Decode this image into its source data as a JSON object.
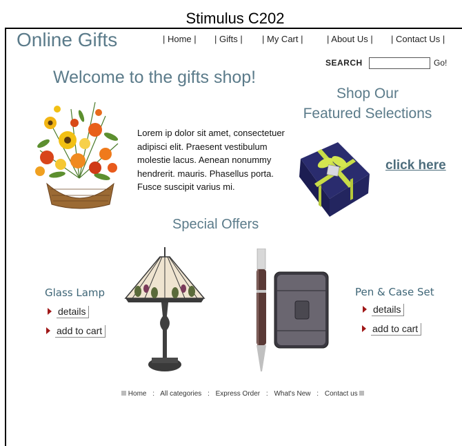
{
  "stimulus_label": "Stimulus C202",
  "site_title": "Online Gifts",
  "nav": {
    "home": "| Home |",
    "gifts": "| Gifts |",
    "my_cart": "| My Cart |",
    "about_us": "| About Us |",
    "contact_us": "| Contact Us |"
  },
  "search": {
    "label": "SEARCH",
    "value": "",
    "go_label": "Go!"
  },
  "welcome_heading": "Welcome to the gifts shop!",
  "featured": {
    "line1": "Shop Our",
    "line2": "Featured Selections",
    "link": "click here"
  },
  "intro_text": "Lorem ip dolor sit amet, consectetuer adipisci elit. Praesent vestibulum molestie lacus. Aenean nonummy hendrerit. mauris. Phasellus porta. Fusce suscipit varius mi.",
  "special_offers_heading": "Special Offers",
  "products": [
    {
      "name": "Glass Lamp",
      "details_label": "details",
      "cart_label": "add to cart"
    },
    {
      "name": "Pen & Case Set",
      "details_label": "details",
      "cart_label": "add to cart"
    }
  ],
  "footer_nav": {
    "home": "Home",
    "all_categories": "All categories",
    "express_order": "Express Order",
    "whats_new": "What's New",
    "contact_us": "Contact us",
    "separator": ":"
  },
  "colors": {
    "heading": "#5b7b8a",
    "product_title": "#3f6677",
    "arrow": "#a01818"
  }
}
